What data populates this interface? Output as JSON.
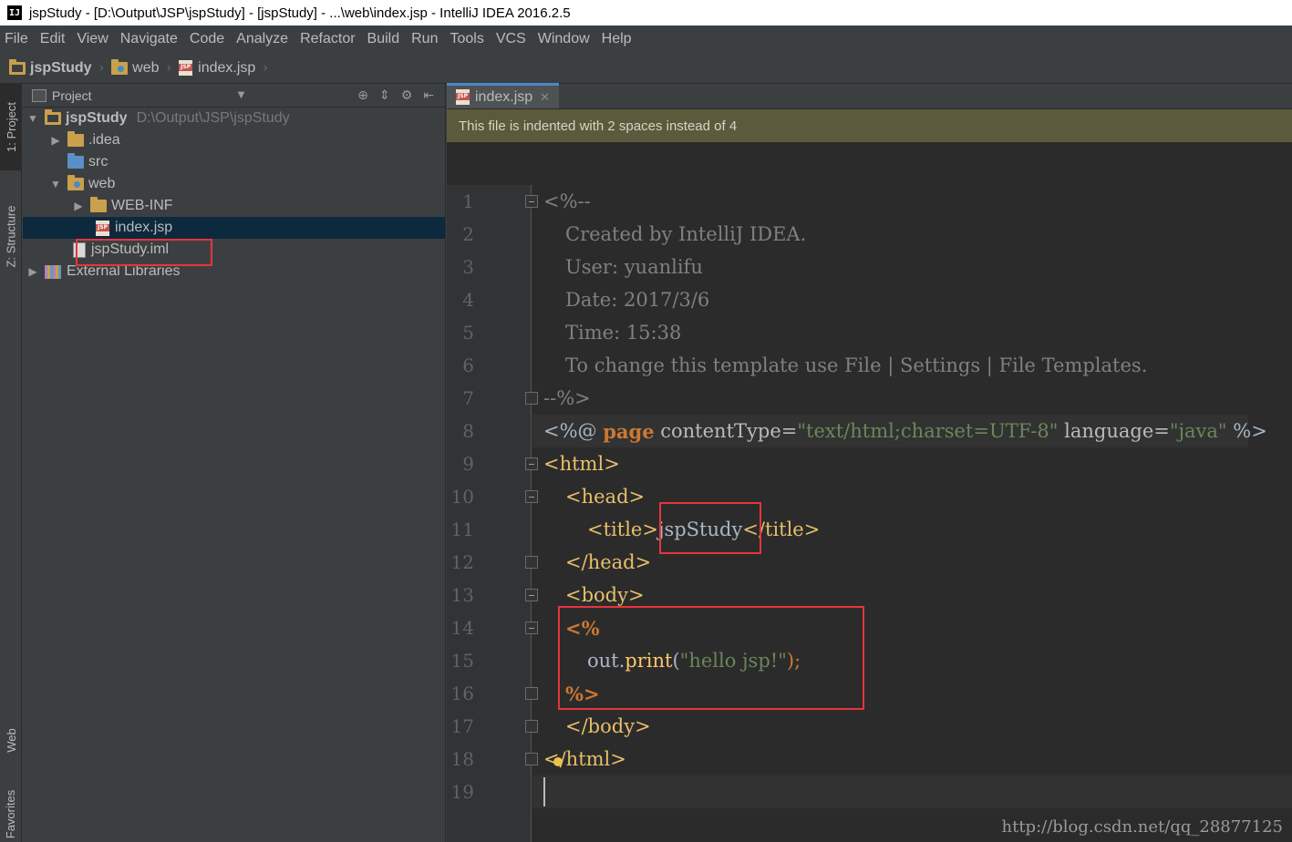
{
  "window": {
    "title": "jspStudy - [D:\\Output\\JSP\\jspStudy] - [jspStudy] - ...\\web\\index.jsp - IntelliJ IDEA 2016.2.5",
    "app_icon": "IJ"
  },
  "menu": [
    "File",
    "Edit",
    "View",
    "Navigate",
    "Code",
    "Analyze",
    "Refactor",
    "Build",
    "Run",
    "Tools",
    "VCS",
    "Window",
    "Help"
  ],
  "breadcrumbs": [
    "jspStudy",
    "web",
    "index.jsp"
  ],
  "left_stripe": {
    "project": "1: Project",
    "structure": "Z: Structure",
    "web": "Web",
    "favorites": "Favorites"
  },
  "project_panel": {
    "header": "Project",
    "tree": [
      {
        "label": "jspStudy",
        "path": "D:\\Output\\JSP\\jspStudy"
      },
      {
        "label": ".idea"
      },
      {
        "label": "src"
      },
      {
        "label": "web"
      },
      {
        "label": "WEB-INF"
      },
      {
        "label": "index.jsp"
      },
      {
        "label": "jspStudy.iml"
      },
      {
        "label": "External Libraries"
      }
    ]
  },
  "editor": {
    "tab": "index.jsp",
    "banner": "This file is indented with 2 spaces instead of 4",
    "line_numbers": [
      "1",
      "2",
      "3",
      "4",
      "5",
      "6",
      "7",
      "8",
      "9",
      "10",
      "11",
      "12",
      "13",
      "14",
      "15",
      "16",
      "17",
      "18",
      "19"
    ],
    "code": {
      "l1": "<%--",
      "l2": "Created by IntelliJ IDEA.",
      "l3": "User: yuanlifu",
      "l4": "Date: 2017/3/6",
      "l5": "Time: 15:38",
      "l6": "To change this template use File | Settings | File Templates.",
      "l7": "--%>",
      "l8_open": "<%@ ",
      "l8_kw": "page",
      "l8_attr1": " contentType=",
      "l8_val1": "\"text/html;charset=UTF-8\"",
      "l8_attr2": " language=",
      "l8_val2": "\"java\"",
      "l8_close": " %>",
      "l9": "<html>",
      "l10": "<head>",
      "l11_open": "<title>",
      "l11_text": "jspStudy",
      "l11_close": "</title>",
      "l12": "</head>",
      "l13": "<body>",
      "l14": "<%",
      "l15_obj": "out",
      "l15_dot": ".",
      "l15_method": "print",
      "l15_paren": "(",
      "l15_str": "\"hello jsp!\"",
      "l15_end": ");",
      "l16": "%>",
      "l17": "</body>",
      "l18": "</html>"
    }
  },
  "watermark": "http://blog.csdn.net/qq_28877125"
}
